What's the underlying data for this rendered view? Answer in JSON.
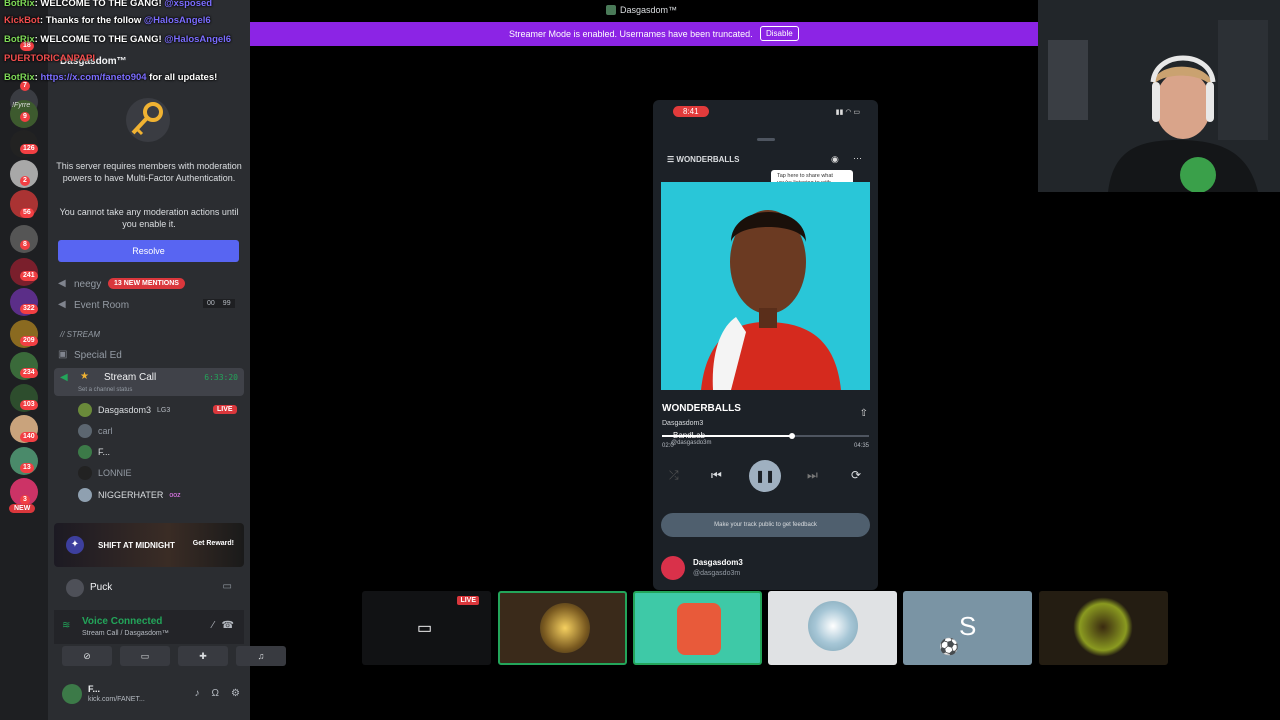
{
  "chat": [
    {
      "user": "BotRix",
      "text": ": WELCOME TO THE GANG! ",
      "mention": "@xsposed"
    },
    {
      "user": "KickBot",
      "text": ": Thanks for the follow ",
      "mention": "@HalosAngel6"
    },
    {
      "user": "BotRix",
      "text": ": WELCOME TO THE GANG! ",
      "mention": "@HalosAngel6"
    },
    {
      "user": "PUERTORICANPAPI",
      "text": "",
      "mention": ""
    },
    {
      "user": "BotRix",
      "text": ": ",
      "link": "https://x.com/faneto904",
      "after": " for all updates!"
    }
  ],
  "rail": {
    "badges": [
      "18",
      "7",
      "9",
      "126",
      "2",
      "56",
      "8",
      "241",
      "322",
      "209",
      "234",
      "103",
      "140",
      "13",
      "3"
    ],
    "new_label": "NEW",
    "brand_label": "!Fyrre"
  },
  "server": {
    "name": "Dasgasdom™",
    "mfa_text": "This server requires members with moderation powers to have Multi-Factor Authentication.",
    "mfa_text2": "You cannot take any moderation actions until you enable it.",
    "resolve_label": "Resolve"
  },
  "channels": {
    "neegy": "neegy",
    "mentions": "13 NEW MENTIONS",
    "event_room": "Event Room",
    "event_counts": [
      "00",
      "99"
    ],
    "category": "// STREAM",
    "special_ed": "Special Ed",
    "stream_call": "Stream Call",
    "stream_time": "6:33:20",
    "stream_status": "Set a channel status"
  },
  "voice_users": [
    {
      "name": "Dasgasdom3",
      "tag": "LG3",
      "live": "LIVE"
    },
    {
      "name": "carl",
      "tag": "",
      "live": ""
    },
    {
      "name": "F...",
      "tag": "",
      "live": ""
    },
    {
      "name": "LONNIE",
      "tag": "",
      "live": ""
    },
    {
      "name": "NIGGERHATER",
      "tag": "ooz",
      "live": ""
    }
  ],
  "reward": {
    "name": "SHIFT AT MIDNIGHT",
    "button": "Get Reward!"
  },
  "puck": "Puck",
  "voice": {
    "status": "Voice Connected",
    "location": "Stream Call / Dasgasdom™"
  },
  "userbar": {
    "name": "F...",
    "status": "kick.com/FANET..."
  },
  "topbar": {
    "title": "Dasgasdom™"
  },
  "streamer_mode": {
    "message": "Streamer Mode is enabled. Usernames have been truncated.",
    "disable": "Disable"
  },
  "phone": {
    "time": "8:41",
    "playlist": "WONDERBALLS",
    "tooltip": "Tap here to share what you're listening to with everyone",
    "title": "WONDERBALLS",
    "artist": "Dasgasdom3",
    "brand": "BandLab",
    "brand_handle": "@dasgasdo3m",
    "elapsed": "02:0",
    "duration": "04:35",
    "progress": 0.63,
    "feedback": "Make your track public to get feedback",
    "owner_name": "Dasgasdom3",
    "owner_handle": "@dasgasdo3m"
  },
  "tiles": {
    "live": "LIVE",
    "s_letter": "S"
  },
  "colors": {
    "accent": "#5865f2",
    "streamer": "#8c24e5",
    "live": "#da373c",
    "online": "#23a55a"
  }
}
